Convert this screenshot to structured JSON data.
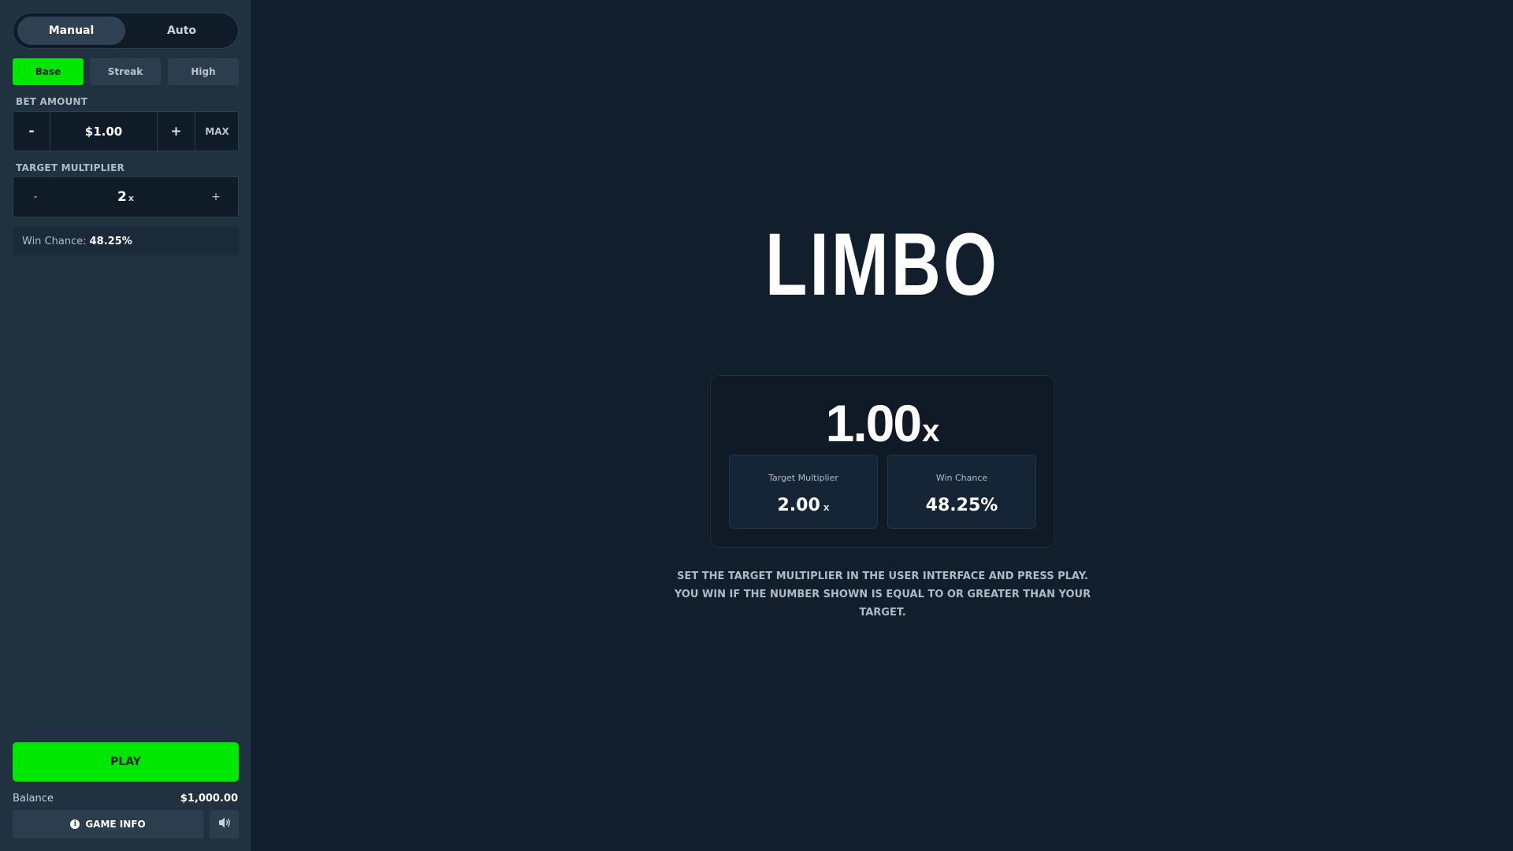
{
  "sidebar": {
    "mode_tabs": {
      "manual": "Manual",
      "auto": "Auto",
      "active": "Manual"
    },
    "presets": {
      "base": "Base",
      "streak": "Streak",
      "high": "High",
      "active": "Base"
    },
    "bet_amount": {
      "label": "BET AMOUNT",
      "minus": "-",
      "value": "$1.00",
      "plus": "+",
      "max": "MAX"
    },
    "target_multiplier": {
      "label": "TARGET MULTIPLIER",
      "minus": "-",
      "value": "2",
      "suffix": "x",
      "plus": "+"
    },
    "win_chance": {
      "label": "Win Chance:",
      "value": "48.25%"
    },
    "play_label": "PLAY",
    "balance": {
      "label": "Balance",
      "value": "$1,000.00"
    },
    "game_info_label": "GAME INFO",
    "icons": {
      "info": "info-icon",
      "sound": "speaker-icon"
    }
  },
  "main": {
    "title": "LIMBO",
    "result": {
      "value": "1.00",
      "suffix": "x"
    },
    "stats": {
      "target_multiplier": {
        "label": "Target Multiplier",
        "value": "2.00",
        "suffix": "x"
      },
      "win_chance": {
        "label": "Win Chance",
        "value": "48.25%"
      }
    },
    "instructions": "SET THE TARGET MULTIPLIER IN THE USER INTERFACE AND PRESS PLAY. YOU WIN IF THE NUMBER SHOWN IS EQUAL TO OR GREATER THAN YOUR TARGET."
  },
  "colors": {
    "background": "#111f2c",
    "sidebar": "#203140",
    "accent_green": "#00e701",
    "panel_dark": "#0f1c28"
  }
}
